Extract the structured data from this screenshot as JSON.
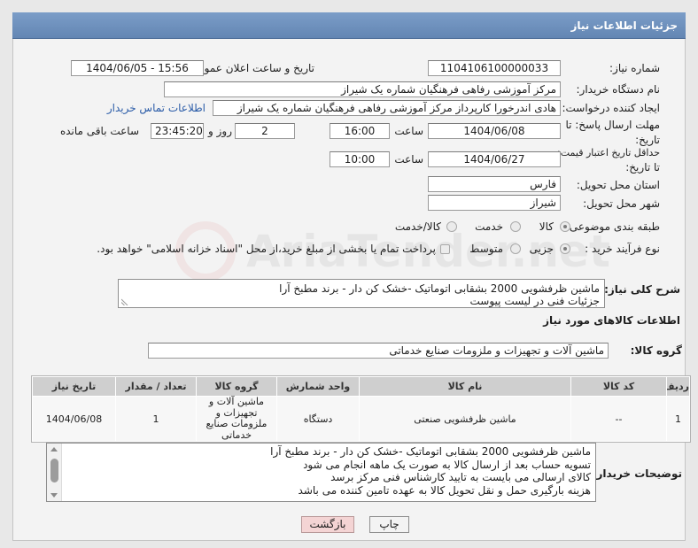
{
  "theme": {
    "header_bg": "#6386b3",
    "link_color": "#2b5ca8",
    "back_button_bg": "#f4d4d4"
  },
  "header": {
    "title": "جزئیات اطلاعات نیاز"
  },
  "watermark": "AriaTender.net",
  "form": {
    "need_number": {
      "label": "شماره نیاز:",
      "value": "1104106100000033"
    },
    "announce": {
      "label": "تاریخ و ساعت اعلان عمومی:",
      "value": "1404/06/05 - 15:56"
    },
    "buyer_org": {
      "label": "نام دستگاه خریدار:",
      "value": "مرکز آموزشی رفاهی فرهنگیان شماره یک شیراز"
    },
    "requester": {
      "label": "ایجاد کننده درخواست:",
      "value": "هادی اندرخورا کارپرداز مرکز آموزشی رفاهی فرهنگیان شماره یک شیراز",
      "contact_link": "اطلاعات تماس خریدار"
    },
    "reply_deadline": {
      "label_line1": "مهلت ارسال پاسخ: تا",
      "label_line2": "تاریخ:",
      "date": "1404/06/08",
      "time_label": "ساعت",
      "time": "16:00",
      "days": "2",
      "days_label": "روز و",
      "remaining": "23:45:20",
      "remaining_label": "ساعت باقی مانده"
    },
    "price_validity": {
      "label_line1": "حداقل تاریخ اعتبار قیمت:",
      "label_line2": "تا تاریخ:",
      "date": "1404/06/27",
      "time_label": "ساعت",
      "time": "10:00"
    },
    "province": {
      "label": "استان محل تحویل:",
      "value": "فارس"
    },
    "city": {
      "label": "شهر محل تحویل:",
      "value": "شیراز"
    },
    "category": {
      "label": "طبقه بندی موضوعی:",
      "options": [
        {
          "label": "کالا",
          "selected": true
        },
        {
          "label": "خدمت",
          "selected": false
        },
        {
          "label": "کالا/خدمت",
          "selected": false
        }
      ]
    },
    "process": {
      "label": "نوع فرآیند خرید :",
      "options": [
        {
          "label": "جزیی",
          "selected": true
        },
        {
          "label": "متوسط",
          "selected": false
        }
      ],
      "treasury": {
        "label": "پرداخت تمام یا بخشی از مبلغ خرید،از محل \"اسناد خزانه اسلامی\" خواهد بود.",
        "checked": false
      }
    }
  },
  "description": {
    "label": "شرح کلی نیاز:",
    "lines": [
      "ماشین ظرفشویی 2000 بشقابی اتوماتیک -خشک کن دار - برند مطبخ آرا",
      "جزئیات فنی در لیست پیوست"
    ]
  },
  "goods": {
    "heading": "اطلاعات کالاهای مورد نیاز",
    "group_label": "گروه کالا:",
    "group_value": "ماشین آلات و تجهیزات و ملزومات صنایع خدماتی",
    "table": {
      "columns": [
        "ردیف",
        "کد کالا",
        "نام کالا",
        "واحد شمارش",
        "گروه کالا",
        "تعداد / مقدار",
        "تاریخ نیاز"
      ],
      "rows": [
        [
          "1",
          "--",
          "ماشین ظرفشویی صنعتی",
          "دستگاه",
          "ماشین آلات و تجهیزات و ملزومات صنایع خدماتی",
          "1",
          "1404/06/08"
        ]
      ]
    }
  },
  "buyer_notes": {
    "label": "توضیحات خریدار:",
    "lines": [
      "ماشین ظرفشویی 2000 بشقابی اتوماتیک -خشک کن دار - برند مطبخ آرا",
      "تسویه حساب بعد از ارسال کالا به صورت یک ماهه انجام می شود",
      "کالای ارسالی می بایست به تایید کارشناس فنی مرکز برسد",
      "هزینه بارگیری حمل و نقل  تحویل کالا به عهده تامین کننده می باشد"
    ]
  },
  "buttons": {
    "print": "چاپ",
    "back": "بازگشت"
  }
}
